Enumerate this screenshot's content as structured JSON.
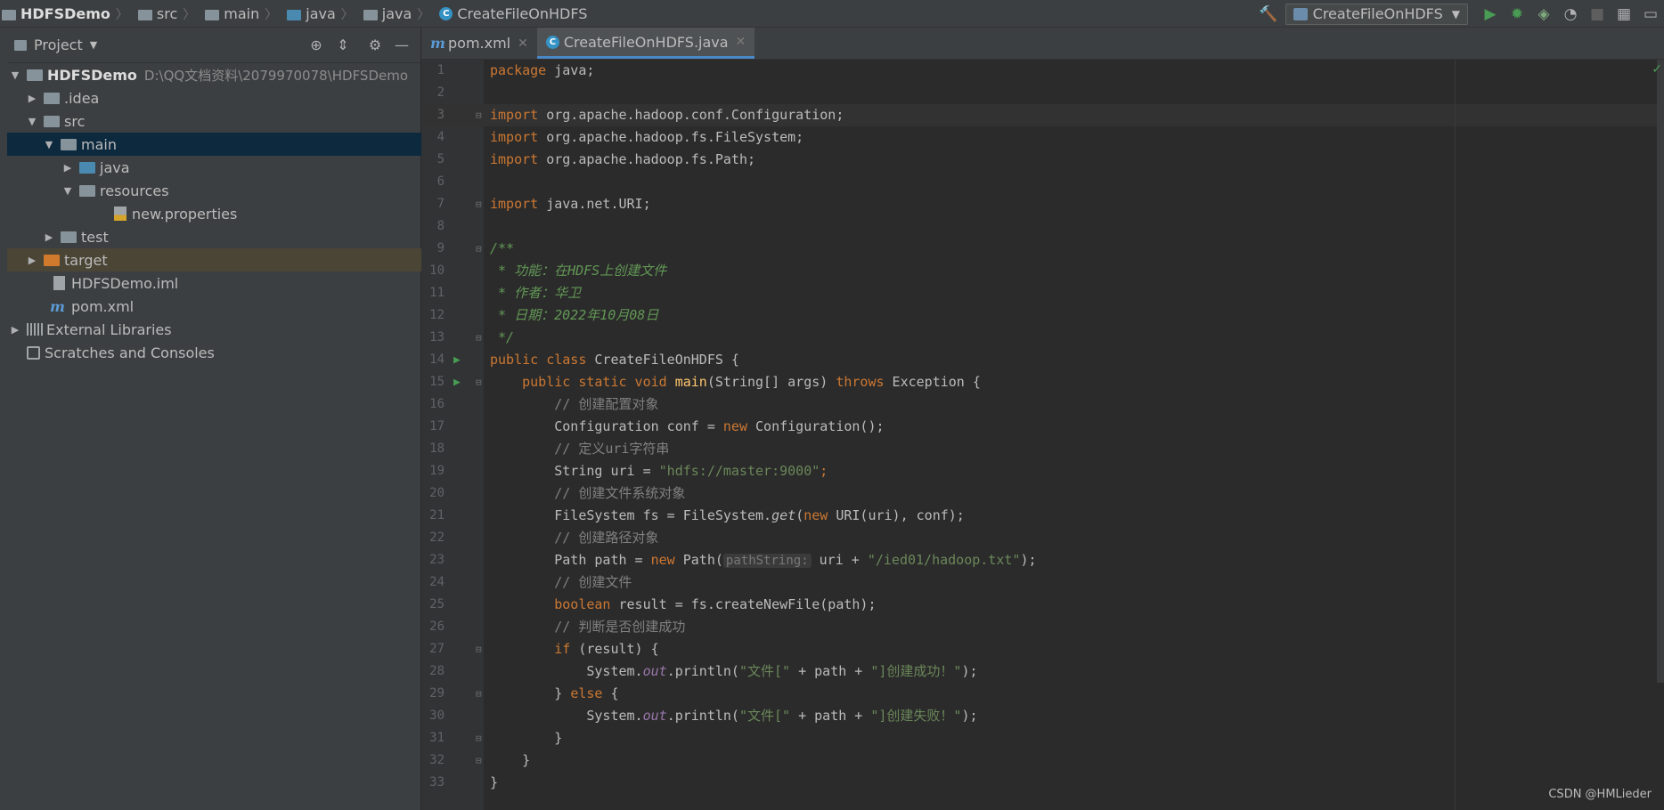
{
  "breadcrumbs": {
    "project": "HDFSDemo",
    "items": [
      "src",
      "main",
      "java",
      "java"
    ],
    "file": "CreateFileOnHDFS"
  },
  "toolbar": {
    "run_config": "CreateFileOnHDFS"
  },
  "project_panel": {
    "title": "Project",
    "tree": [
      {
        "label": "HDFSDemo",
        "path": "D:\\QQ文档资料\\2079970078\\HDFSDemo"
      },
      {
        "label": ".idea"
      },
      {
        "label": "src"
      },
      {
        "label": "main"
      },
      {
        "label": "java"
      },
      {
        "label": "resources"
      },
      {
        "label": "new.properties"
      },
      {
        "label": "test"
      },
      {
        "label": "target"
      },
      {
        "label": "HDFSDemo.iml"
      },
      {
        "label": "pom.xml"
      },
      {
        "label": "External Libraries"
      },
      {
        "label": "Scratches and Consoles"
      }
    ]
  },
  "tabs": [
    {
      "label": "pom.xml"
    },
    {
      "label": "CreateFileOnHDFS.java"
    }
  ],
  "code": {
    "line_numbers": [
      "1",
      "2",
      "3",
      "4",
      "5",
      "6",
      "7",
      "8",
      "9",
      "10",
      "11",
      "12",
      "13",
      "14",
      "15",
      "16",
      "17",
      "18",
      "19",
      "20",
      "21",
      "22",
      "23",
      "24",
      "25",
      "26",
      "27",
      "28",
      "29",
      "30",
      "31",
      "32",
      "33"
    ],
    "l1_kw": "package",
    "l1_rest": " java;",
    "l3_kw": "import",
    "l3_rest": " org.apache.hadoop.conf.Configuration;",
    "l4_kw": "import",
    "l4_rest": " org.apache.hadoop.fs.FileSystem;",
    "l5_kw": "import",
    "l5_rest": " org.apache.hadoop.fs.Path;",
    "l7_kw": "import",
    "l7_rest": " java.net.URI;",
    "l9": "/**",
    "l10": " * 功能：在HDFS上创建文件",
    "l11": " * 作者：华卫",
    "l12": " * 日期：2022年10月08日",
    "l13": " */",
    "l14_kw": "public class",
    "l14_rest": " CreateFileOnHDFS {",
    "l15_kw": "public static void",
    "l15_fn": "main",
    "l15_a": "(String[] args) ",
    "l15_kw2": "throws",
    "l15_b": " Exception {",
    "l16": "// 创建配置对象",
    "l17_a": "Configuration conf = ",
    "l17_kw": "new",
    "l17_b": " Configuration();",
    "l18": "// 定义uri字符串",
    "l19_a": "String uri = ",
    "l19_str": "\"hdfs://master:9000\"",
    "l19_b": ";",
    "l20": "// 创建文件系统对象",
    "l21_a": "FileSystem fs = FileSystem.",
    "l21_st": "get",
    "l21_b": "(",
    "l21_kw": "new",
    "l21_c": " URI(uri), conf);",
    "l22": "// 创建路径对象",
    "l23_a": "Path path = ",
    "l23_kw": "new",
    "l23_b": " Path(",
    "l23_hint": "pathString:",
    "l23_c": " uri + ",
    "l23_str": "\"/ied01/hadoop.txt\"",
    "l23_d": ");",
    "l24": "// 创建文件",
    "l25_kw": "boolean",
    "l25_rest": " result = fs.createNewFile(path);",
    "l26": "// 判断是否创建成功",
    "l27_kw": "if",
    "l27_rest": " (result) {",
    "l28_a": "System.",
    "l28_st": "out",
    "l28_b": ".println(",
    "l28_s1": "\"文件[\"",
    "l28_c": " + path + ",
    "l28_s2": "\"]创建成功！\"",
    "l28_d": ");",
    "l29_a": "} ",
    "l29_kw": "else",
    "l29_b": " {",
    "l30_a": "System.",
    "l30_st": "out",
    "l30_b": ".println(",
    "l30_s1": "\"文件[\"",
    "l30_c": " + path + ",
    "l30_s2": "\"]创建失败！\"",
    "l30_d": ");",
    "l31": "}",
    "l32": "}",
    "l33": "}"
  },
  "watermark": "CSDN @HMLieder",
  "icons": {
    "hammer": "hammer-icon",
    "run": "run-icon",
    "debug": "debug-icon",
    "coverage": "coverage-icon",
    "profile": "profile-icon",
    "stop": "stop-icon"
  },
  "colors": {
    "keyword": "#cc7832",
    "string": "#6a8759",
    "comment": "#808080",
    "doc_comment": "#629755",
    "method": "#ffc66d",
    "static_field": "#9876aa",
    "selection": "#0d293e",
    "run_green": "#499c54"
  }
}
